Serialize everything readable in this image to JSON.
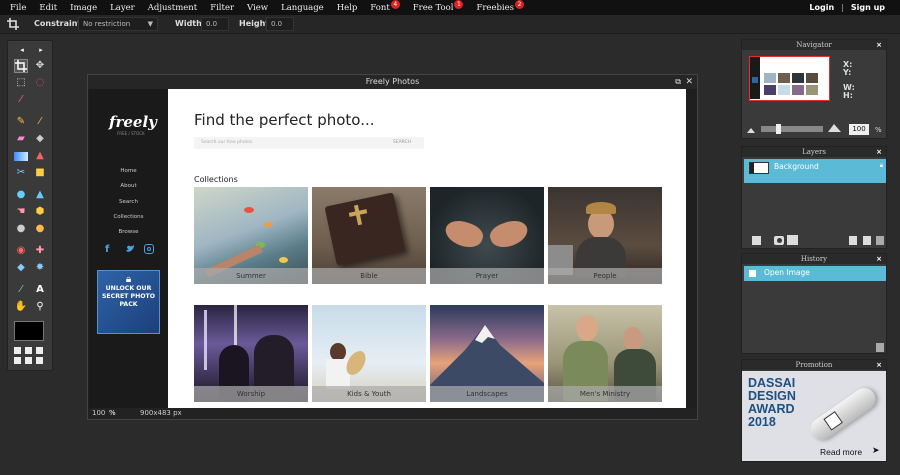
{
  "menu": {
    "items": [
      "File",
      "Edit",
      "Image",
      "Layer",
      "Adjustment",
      "Filter",
      "View",
      "Language",
      "Help",
      "Font",
      "Free Tool",
      "Freebies"
    ],
    "badges": {
      "font": "4",
      "free_tool": "1",
      "freebies": "2"
    },
    "login": "Login",
    "separator": "|",
    "signup": "Sign up"
  },
  "options": {
    "constraint_label": "Constraint:",
    "constraint_value": "No restriction",
    "width_label": "Width:",
    "width_value": "0.0",
    "height_label": "Height:",
    "height_value": "0.0"
  },
  "document": {
    "title": "Freely Photos",
    "zoom": "100",
    "zoom_unit": "%",
    "size": "900x483 px"
  },
  "site": {
    "logo": "freely",
    "logo_sub": "FREE / STOCK",
    "nav": [
      "Home",
      "About",
      "Search",
      "Collections",
      "Browse"
    ],
    "promo": "UNLOCK OUR SECRET PHOTO PACK",
    "headline": "Find the perfect photo...",
    "search_placeholder": "Search our free photos",
    "search_button": "SEARCH",
    "collections_heading": "Collections",
    "collections": [
      "Summer",
      "Bible",
      "Prayer",
      "People",
      "Worship",
      "Kids & Youth",
      "Landscapes",
      "Men's Ministry"
    ]
  },
  "navigator": {
    "title": "Navigator",
    "x_label": "X:",
    "y_label": "Y:",
    "w_label": "W:",
    "h_label": "H:",
    "zoom_value": "100",
    "zoom_unit": "%"
  },
  "layers": {
    "title": "Layers",
    "items": [
      {
        "name": "Background"
      }
    ]
  },
  "history": {
    "title": "History",
    "items": [
      "Open Image"
    ]
  },
  "promotion": {
    "title": "Promotion",
    "line1": "DASSAI",
    "line2": "DESIGN",
    "line3": "AWARD",
    "line4": "2018",
    "cta": "Read more"
  },
  "colors": {
    "accent": "#5bbad5",
    "badge": "#e02020",
    "promo_bg": "#dfe0e6",
    "promo_text": "#1e5080"
  }
}
